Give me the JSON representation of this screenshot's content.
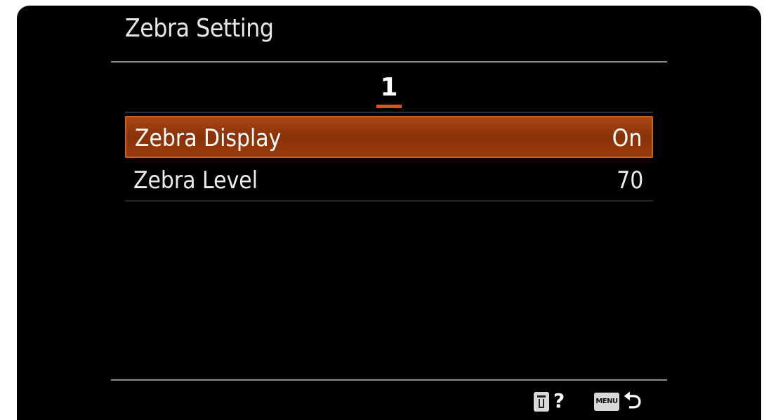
{
  "screen": {
    "title": "Zebra Setting",
    "page_number": "1"
  },
  "menu": {
    "items": [
      {
        "label": "Zebra Display",
        "value": "On",
        "selected": true
      },
      {
        "label": "Zebra Level",
        "value": "70",
        "selected": false
      }
    ]
  },
  "footer": {
    "delete_icon": "trash-icon",
    "help_label": "?",
    "menu_label": "MENU",
    "back_icon": "back-arrow-icon"
  },
  "colors": {
    "background": "#000000",
    "selection": "#9a3b0d",
    "accent": "#d05818",
    "text": "#ececec"
  }
}
